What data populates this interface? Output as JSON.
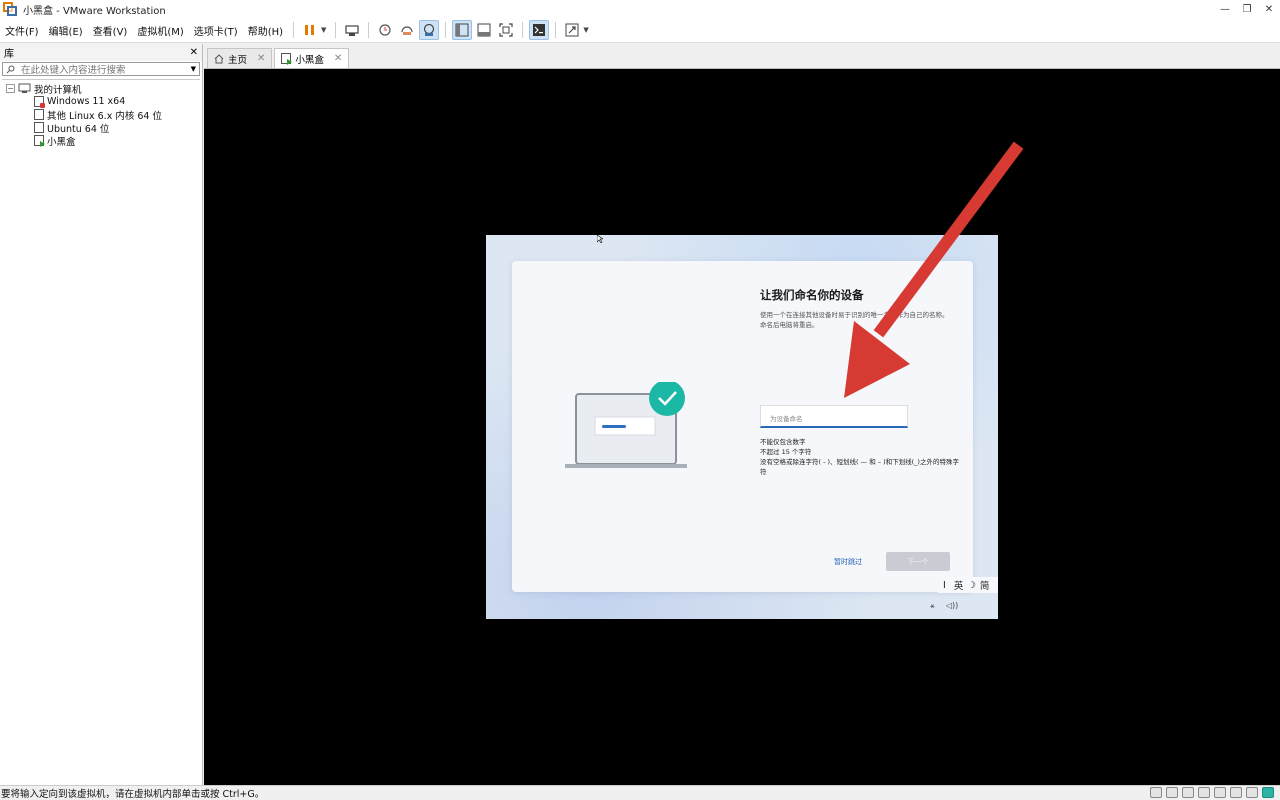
{
  "window": {
    "title": "小黑盒 - VMware Workstation",
    "controls": {
      "minimize": "—",
      "restore": "❐",
      "close": "✕"
    }
  },
  "menu": {
    "items": [
      "文件(F)",
      "编辑(E)",
      "查看(V)",
      "虚拟机(M)",
      "选项卡(T)",
      "帮助(H)"
    ]
  },
  "toolbar": {
    "icons": [
      "pause-icon",
      "send-ctrl-alt-del-icon",
      "snapshot-icon",
      "revert-snapshot-icon",
      "manage-snapshots-icon",
      "show-library-icon",
      "thumbnail-bar-icon",
      "full-screen-icon",
      "console-view-icon",
      "stretch-guest-icon"
    ]
  },
  "library": {
    "title": "库",
    "close": "✕",
    "search_placeholder": "在此处键入内容进行搜索",
    "root_label": "我的计算机",
    "vms": [
      {
        "label": "Windows 11 x64",
        "status": "red"
      },
      {
        "label": "其他 Linux 6.x 内核 64 位",
        "status": "none"
      },
      {
        "label": "Ubuntu 64 位",
        "status": "none"
      },
      {
        "label": "小黑盒",
        "status": "green"
      }
    ]
  },
  "tabs": [
    {
      "label": "主页",
      "close": "✕"
    },
    {
      "label": "小黑盒",
      "close": "✕"
    }
  ],
  "guest": {
    "title": "让我们命名你的设备",
    "description": "使用一个在连接其他设备时易于识别的唯一名称作为自己的名称。命名后电脑将重启。",
    "input_placeholder": "为设备命名",
    "rules": [
      "不能仅包含数字",
      "不超过 15 个字符",
      "没有空格或除连字符( - )、短划线( — 和 – )和下划线(_)之外的特殊字符"
    ],
    "skip_label": "暂时跳过",
    "next_label": "下一个",
    "ime": {
      "cursor": "I",
      "lang": "英",
      "moon": "☽",
      "mode": "简"
    },
    "tray": {
      "network": "⚹",
      "volume": "◁))"
    }
  },
  "annotation": {
    "arrow_color": "#d63a32"
  },
  "status": {
    "text": "要将输入定向到该虚拟机，请在虚拟机内部单击或按 Ctrl+G。"
  },
  "colors": {
    "accent": "#2868b8",
    "check_teal": "#1cb8a6"
  }
}
